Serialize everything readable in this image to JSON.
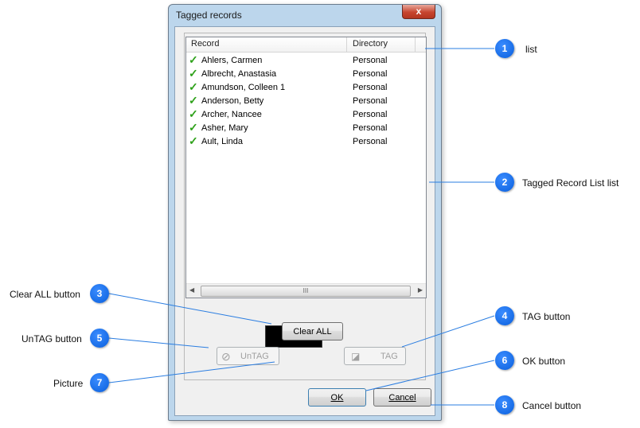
{
  "window": {
    "title": "Tagged records",
    "close_label": "x"
  },
  "list": {
    "columns": [
      "Record",
      "Directory"
    ],
    "rows": [
      {
        "name": "Ahlers, Carmen",
        "directory": "Personal"
      },
      {
        "name": "Albrecht, Anastasia",
        "directory": "Personal"
      },
      {
        "name": "Amundson, Colleen 1",
        "directory": "Personal"
      },
      {
        "name": "Anderson, Betty",
        "directory": "Personal"
      },
      {
        "name": "Archer, Nancee",
        "directory": "Personal"
      },
      {
        "name": "Asher, Mary",
        "directory": "Personal"
      },
      {
        "name": "Ault, Linda",
        "directory": "Personal"
      }
    ],
    "scroll_thumb_label": "III"
  },
  "buttons": {
    "clear_all": "Clear ALL",
    "untag": "UnTAG",
    "tag": "TAG",
    "ok": "OK",
    "cancel": "Cancel"
  },
  "counter": "7",
  "callouts": [
    {
      "number": "1",
      "label": "list"
    },
    {
      "number": "2",
      "label": "Tagged Record List list"
    },
    {
      "number": "3",
      "label": "Clear ALL button"
    },
    {
      "number": "4",
      "label": "TAG button"
    },
    {
      "number": "5",
      "label": "UnTAG button"
    },
    {
      "number": "6",
      "label": "OK button"
    },
    {
      "number": "7",
      "label": "Picture"
    },
    {
      "number": "8",
      "label": "Cancel button"
    }
  ],
  "colors": {
    "callout": "#0a5fdc",
    "accent_counter": "#33c6f2",
    "check": "#2ea11a"
  }
}
